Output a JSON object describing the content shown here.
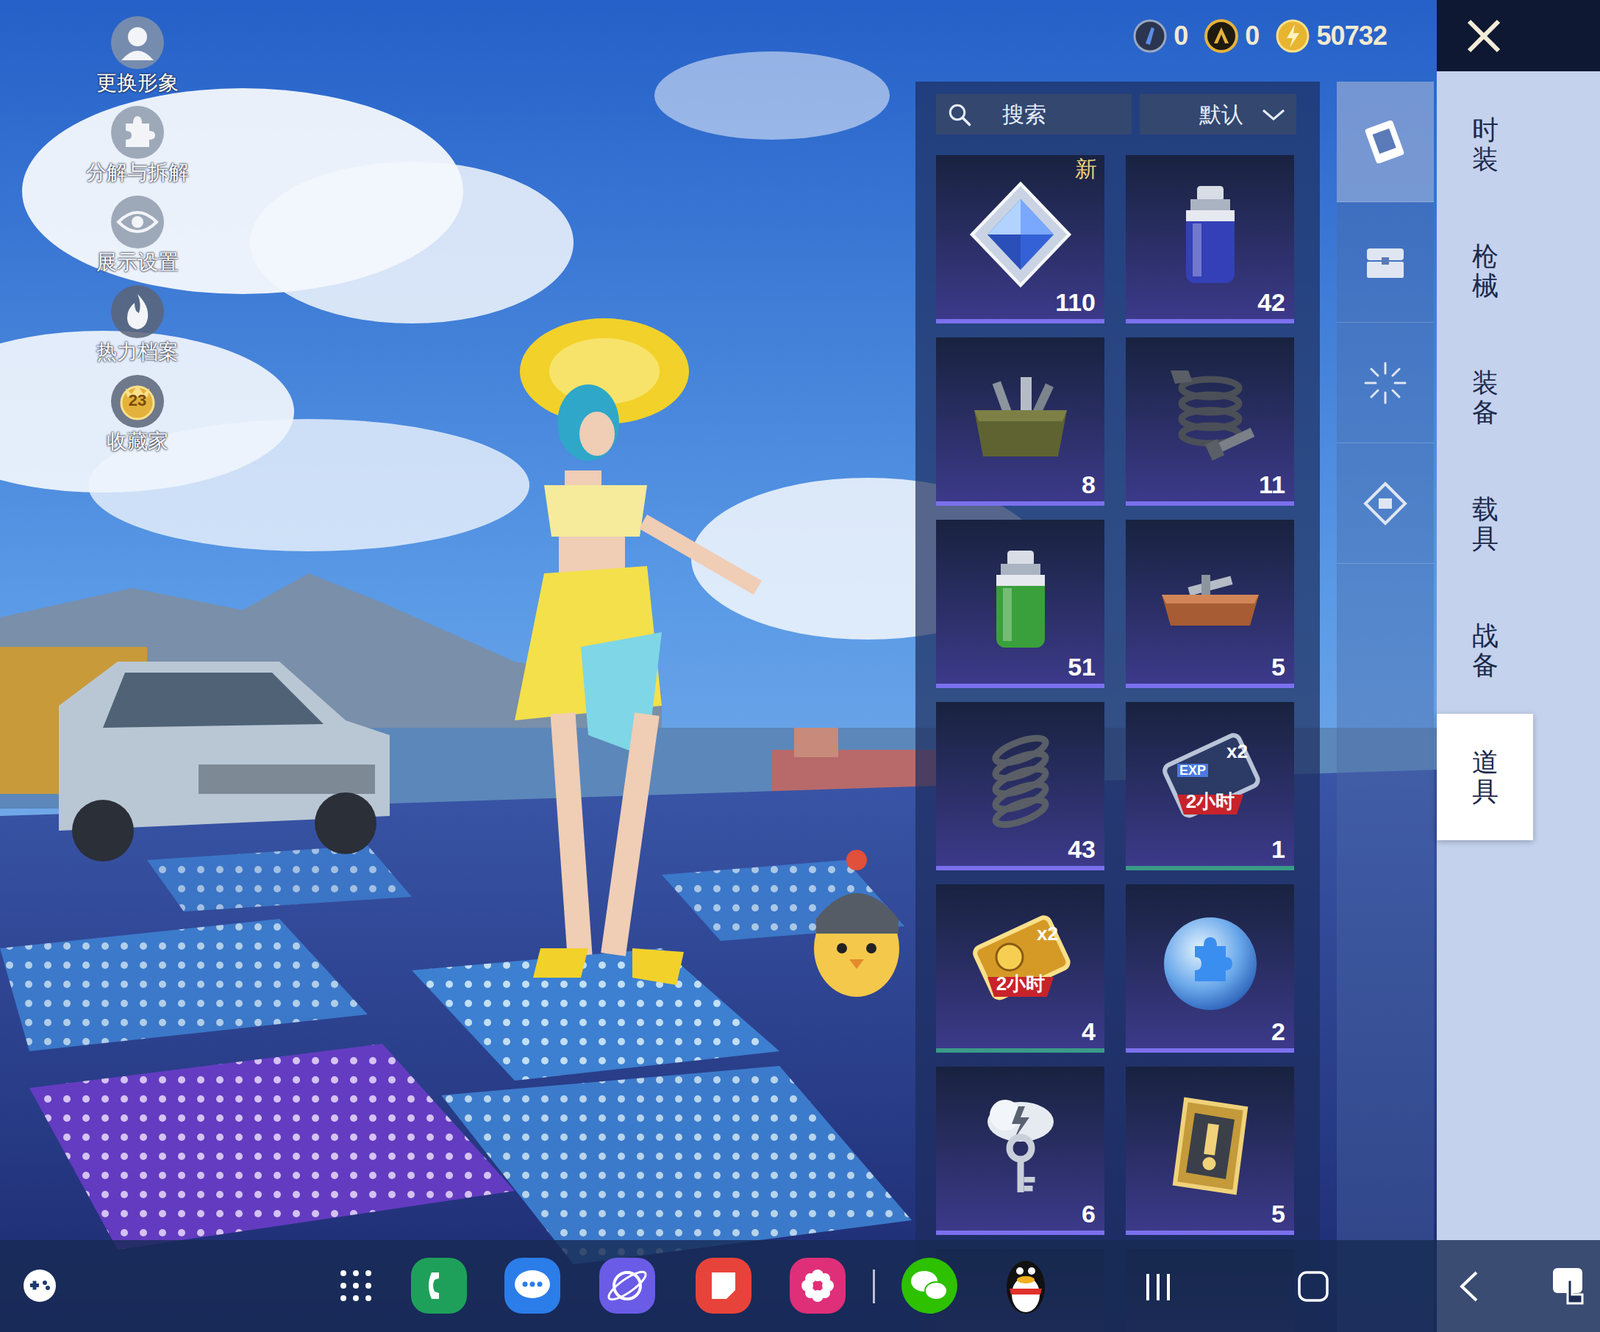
{
  "side_menu": [
    {
      "label": "更换形象"
    },
    {
      "label": "分解与拆解"
    },
    {
      "label": "展示设置"
    },
    {
      "label": "热力档案"
    },
    {
      "label": "收藏家",
      "badge": "23"
    }
  ],
  "currencies": [
    {
      "amount": "0"
    },
    {
      "amount": "0"
    },
    {
      "amount": "50732"
    }
  ],
  "search": {
    "label": "搜索"
  },
  "sort": {
    "label": "默认"
  },
  "subtabs": [
    {
      "selected": true
    },
    {
      "selected": false
    },
    {
      "selected": false
    },
    {
      "selected": false
    }
  ],
  "categories": [
    {
      "label": "时装",
      "selected": false
    },
    {
      "label": "枪械",
      "selected": false
    },
    {
      "label": "装备",
      "selected": false
    },
    {
      "label": "载具",
      "selected": false
    },
    {
      "label": "战备",
      "selected": false
    },
    {
      "label": "道具",
      "selected": true
    }
  ],
  "items": [
    {
      "kind": "crystal",
      "count": "110",
      "new_badge": "新",
      "color": "#7b70ee"
    },
    {
      "kind": "blue-spray",
      "count": "42",
      "color": "#7b70ee"
    },
    {
      "kind": "crate",
      "count": "8",
      "color": "#7b70ee"
    },
    {
      "kind": "spring-bolt",
      "count": "11",
      "color": "#7b70ee"
    },
    {
      "kind": "green-spray",
      "count": "51",
      "color": "#7b70ee"
    },
    {
      "kind": "tray",
      "count": "5",
      "color": "#7b70ee"
    },
    {
      "kind": "spring",
      "count": "43",
      "color": "#7b70ee"
    },
    {
      "kind": "exp-card",
      "count": "1",
      "icon_text": [
        "EXP",
        "x2",
        "2小时"
      ],
      "color": "#3a9a88"
    },
    {
      "kind": "coin-card",
      "count": "4",
      "icon_text": [
        "x2",
        "2小时"
      ],
      "color": "#3a9a88"
    },
    {
      "kind": "puzzle-orb",
      "count": "2",
      "color": "#7b70ee"
    },
    {
      "kind": "key",
      "count": "6",
      "color": "#7b70ee"
    },
    {
      "kind": "badge",
      "count": "5",
      "color": "#7b70ee"
    }
  ]
}
